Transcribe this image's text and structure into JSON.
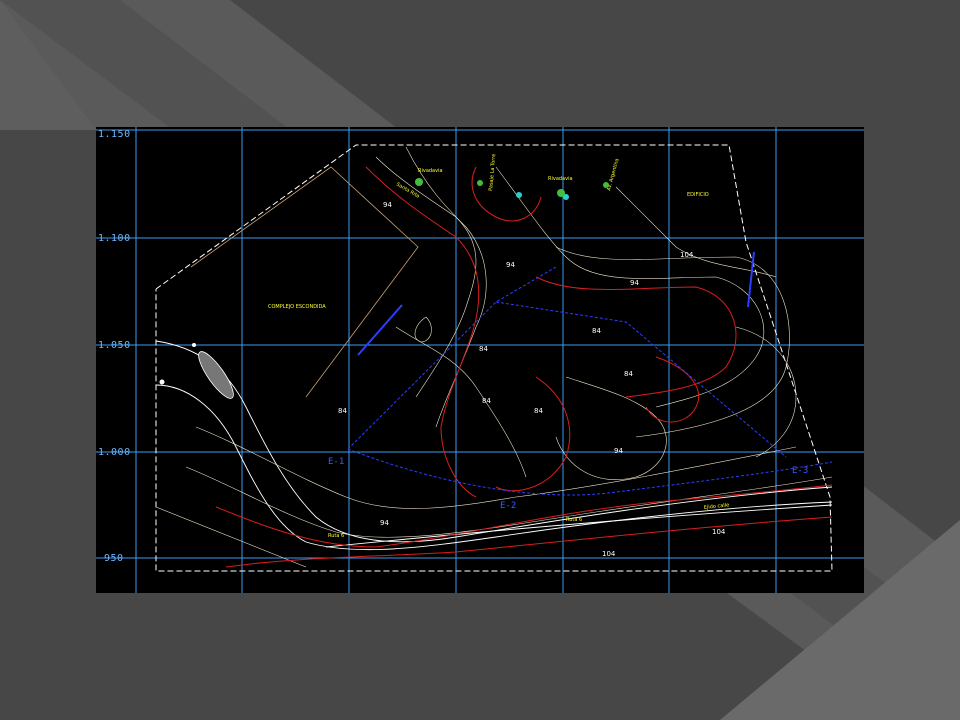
{
  "colors": {
    "slide_bg": "#4a4a4a",
    "panel_bg": "#000000",
    "grid": "#3c9cf0",
    "contour_major": "#d81e1e",
    "contour_minor": "#f1e6c8",
    "boundary": "#ffffff",
    "section_line": "#2b3fff",
    "street_label": "#ffff33"
  },
  "y_axis": [
    "1.150",
    "1.100",
    "1.050",
    "1.000",
    "950"
  ],
  "elevations": [
    "94",
    "94",
    "104",
    "94",
    "84",
    "84",
    "84",
    "84",
    "84",
    "84",
    "94",
    "94",
    "104",
    "104"
  ],
  "labels": {
    "complex": "COMPLEJO ESCONDIDA",
    "building": "EDIFICIO",
    "street_1": "Rivadavia",
    "street_2": "Rivadavia",
    "street_3": "Santa Rita",
    "street_4": "Pasaje La Torre",
    "street_5": "Av. Argentina",
    "route_1": "Ruta 6",
    "route_2": "Ruta 6",
    "route_3": "Ejido calle"
  },
  "sections": [
    "E-1",
    "E-2",
    "E-3"
  ]
}
